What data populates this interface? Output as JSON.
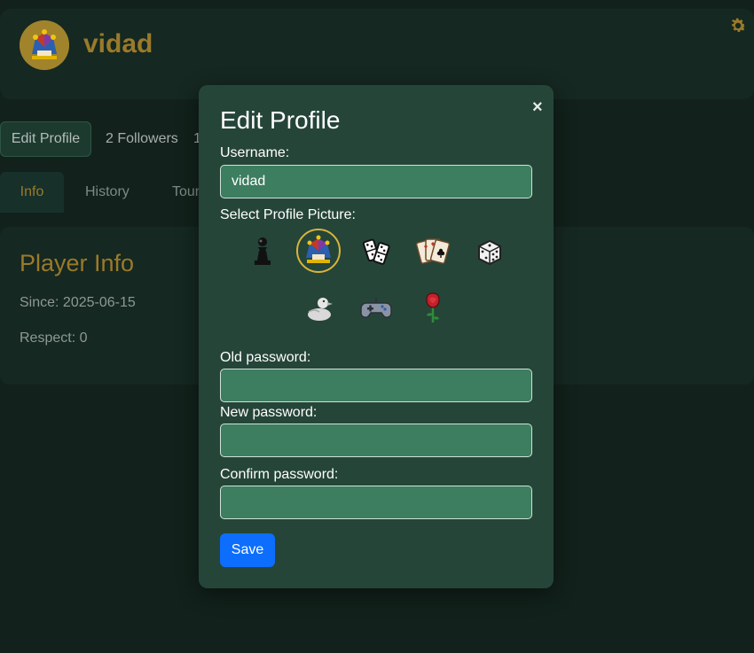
{
  "header": {
    "username": "vidad",
    "avatar_icon": "jester-icon",
    "settings_icon": "gear-icon"
  },
  "profile_bar": {
    "edit_profile_label": "Edit Profile",
    "followers_label": "2 Followers",
    "following_partial": "1"
  },
  "tabs": [
    {
      "label": "Info",
      "active": true
    },
    {
      "label": "History",
      "active": false
    },
    {
      "label": "Tour",
      "active": false
    }
  ],
  "player_info": {
    "title": "Player Info",
    "since": "Since: 2025-06-15",
    "respect": "Respect: 0"
  },
  "modal": {
    "title": "Edit Profile",
    "close_label": "×",
    "username_label": "Username:",
    "username_value": "vidad",
    "picture_label": "Select Profile Picture:",
    "pictures": [
      {
        "name": "pawn-icon",
        "selected": false
      },
      {
        "name": "jester-icon",
        "selected": true
      },
      {
        "name": "dominoes-icon",
        "selected": false
      },
      {
        "name": "playing-cards-icon",
        "selected": false
      },
      {
        "name": "dice-icon",
        "selected": false
      },
      {
        "name": "duck-icon",
        "selected": false
      },
      {
        "name": "gamepad-icon",
        "selected": false
      },
      {
        "name": "rose-icon",
        "selected": false
      }
    ],
    "old_password_label": "Old password:",
    "new_password_label": "New password:",
    "confirm_password_label": "Confirm password:",
    "save_label": "Save"
  },
  "colors": {
    "page_bg": "#12211b",
    "card_bg": "#152821",
    "accent_gold": "#9a7a2a",
    "modal_bg": "#254538",
    "input_bg": "#3d7d60",
    "save_button": "#0d6efd"
  }
}
